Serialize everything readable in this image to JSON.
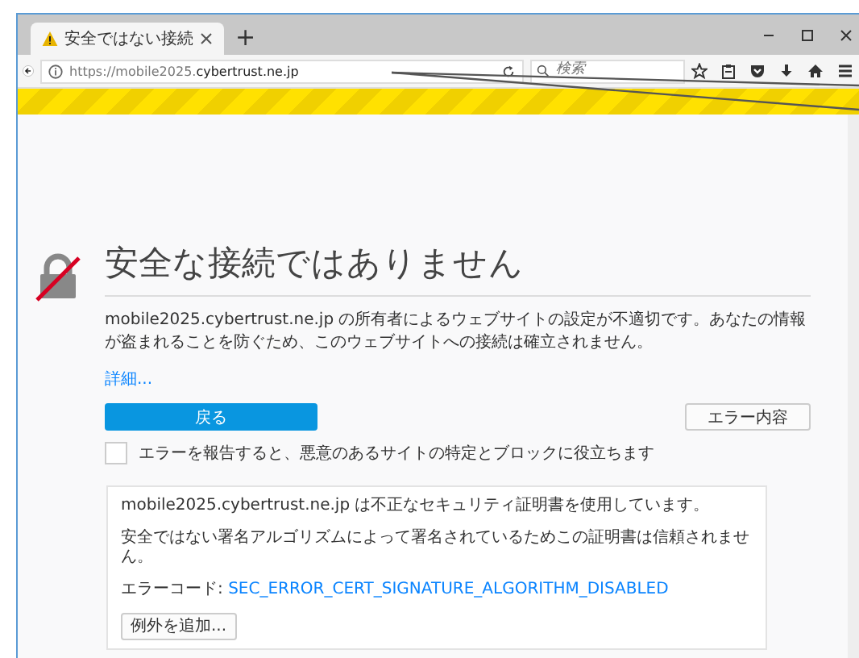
{
  "tab": {
    "title": "安全ではない接続",
    "selected": true
  },
  "new_tab": "+",
  "address_bar": {
    "url_scheme": "https://mobile2025.",
    "url_host": "cybertrust.ne.jp"
  },
  "search": {
    "placeholder": "検索"
  },
  "error": {
    "title": "安全な接続ではありません",
    "description": "mobile2025.cybertrust.ne.jp の所有者によるウェブサイトの設定が不適切です。あなたの情報が盗まれることを防ぐため、このウェブサイトへの接続は確立されません。",
    "details_link": "詳細...",
    "back_button": "戻る",
    "advanced_button": "エラー内容",
    "report": {
      "label": "エラーを報告すると、悪意のあるサイトの特定とブロックに役立ちます",
      "checked": false
    }
  },
  "advanced": {
    "message": "mobile2025.cybertrust.ne.jp は不正なセキュリティ証明書を使用しています。",
    "reason": "安全ではない署名アルゴリズムによって署名されているためこの証明書は信頼されません。",
    "error_code_label": "エラーコード:",
    "error_code": "SEC_ERROR_CERT_SIGNATURE_ALGORITHM_DISABLED",
    "exception_button": "例外を追加..."
  }
}
